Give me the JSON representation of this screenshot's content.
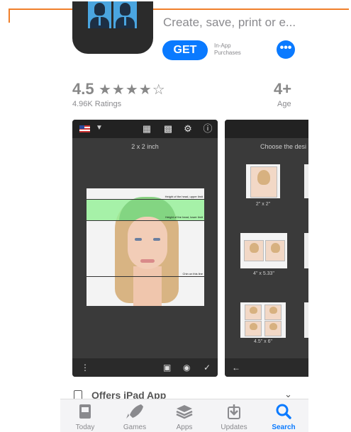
{
  "app": {
    "subtitle": "Create, save, print or e...",
    "get_label": "GET",
    "iap_line1": "In-App",
    "iap_line2": "Purchases",
    "more_label": "•••"
  },
  "ratings": {
    "score": "4.5",
    "stars": "★★★★☆",
    "count": "4.96K Ratings",
    "age": "4+",
    "age_label": "Age"
  },
  "screenshot1": {
    "size_label": "2 x 2 inch",
    "guide_upper": "Height of the head, upper limit",
    "guide_lower": "Height of the head, lower limit",
    "guide_chin": "Chin on this line"
  },
  "screenshot2": {
    "heading": "Choose the desi",
    "options": [
      "2\" x 2\"",
      "4\" x 5.33\"",
      "4.5\" x 6\""
    ]
  },
  "offers": {
    "label": "Offers iPad App"
  },
  "tabs": [
    {
      "label": "Today",
      "icon": "today-icon"
    },
    {
      "label": "Games",
      "icon": "rocket-icon"
    },
    {
      "label": "Apps",
      "icon": "layers-icon"
    },
    {
      "label": "Updates",
      "icon": "download-icon"
    },
    {
      "label": "Search",
      "icon": "search-icon"
    }
  ],
  "colors": {
    "accent": "#0a7aff",
    "annotation": "#f07f2a"
  }
}
